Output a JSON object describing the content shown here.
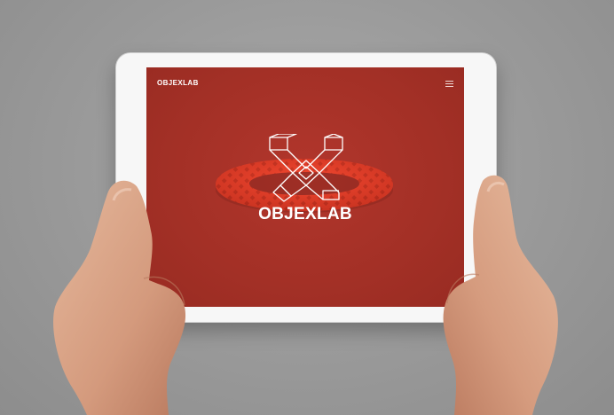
{
  "header": {
    "brand": "OBJEXLAB",
    "menu_icon": "hamburger-menu-icon"
  },
  "hero": {
    "logo_text": "OBJEXLAB",
    "logo_icon": "objexlab-x-logo-icon"
  },
  "colors": {
    "screen_background": "#a33026",
    "bracelet": "#f0402a",
    "text": "#ffffff"
  }
}
